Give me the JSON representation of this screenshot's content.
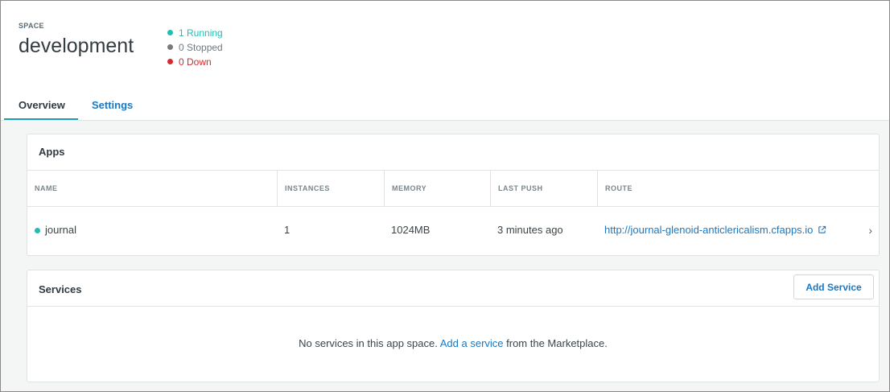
{
  "header": {
    "space_label": "SPACE",
    "space_name": "development",
    "statuses": {
      "running": "1 Running",
      "stopped": "0 Stopped",
      "down": "0 Down"
    }
  },
  "tabs": [
    {
      "label": "Overview",
      "active": true
    },
    {
      "label": "Settings",
      "active": false
    }
  ],
  "apps": {
    "title": "Apps",
    "columns": [
      "NAME",
      "INSTANCES",
      "MEMORY",
      "LAST PUSH",
      "ROUTE"
    ],
    "rows": [
      {
        "name": "journal",
        "status": "running",
        "instances": "1",
        "memory": "1024MB",
        "last_push": "3 minutes ago",
        "route": "http://journal-glenoid-anticlericalism.cfapps.io"
      }
    ]
  },
  "services": {
    "title": "Services",
    "add_button": "Add Service",
    "empty_before": "No services in this app space.",
    "empty_link": "Add a service",
    "empty_after": "from the Marketplace."
  },
  "colors": {
    "running": "#1dbfb2",
    "stopped": "#7a7a7a",
    "down": "#d9282e",
    "link": "#1a78c2",
    "tab_underline": "#1a9eb0"
  },
  "icons": {
    "status": "status-dot-icon",
    "external_link": "external-link-icon",
    "row_chevron": "chevron-right-icon"
  }
}
